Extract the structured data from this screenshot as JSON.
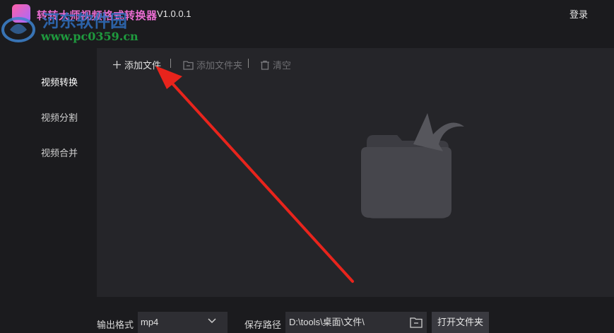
{
  "header": {
    "app_title": "转转大师视频格式转换器",
    "version": "V1.0.0.1",
    "login_label": "登录",
    "watermark_text": "河东软件园",
    "watermark_url": "www.pc0359.cn"
  },
  "sidebar": {
    "items": [
      {
        "label": "视频转换",
        "active": true
      },
      {
        "label": "视频分割",
        "active": false
      },
      {
        "label": "视频合并",
        "active": false
      }
    ]
  },
  "toolbar": {
    "add_file_label": "添加文件",
    "add_folder_label": "添加文件夹",
    "clear_label": "清空"
  },
  "bottom": {
    "format_label": "输出格式",
    "format_value": "mp4",
    "save_path_label": "保存路径",
    "save_path_value": "D:\\tools\\桌面\\文件\\",
    "open_folder_label": "打开文件夹"
  },
  "colors": {
    "background": "#1b1b1e",
    "panel": "#252529",
    "annotation_arrow": "#e8241c",
    "title_accent": "#e86cd0"
  },
  "icons": {
    "app_logo": "app-logo-icon",
    "add": "plus-icon",
    "folder": "folder-icon",
    "clear": "trash-icon",
    "dropdown": "chevron-down-icon",
    "empty_state": "folder-upload-icon"
  }
}
